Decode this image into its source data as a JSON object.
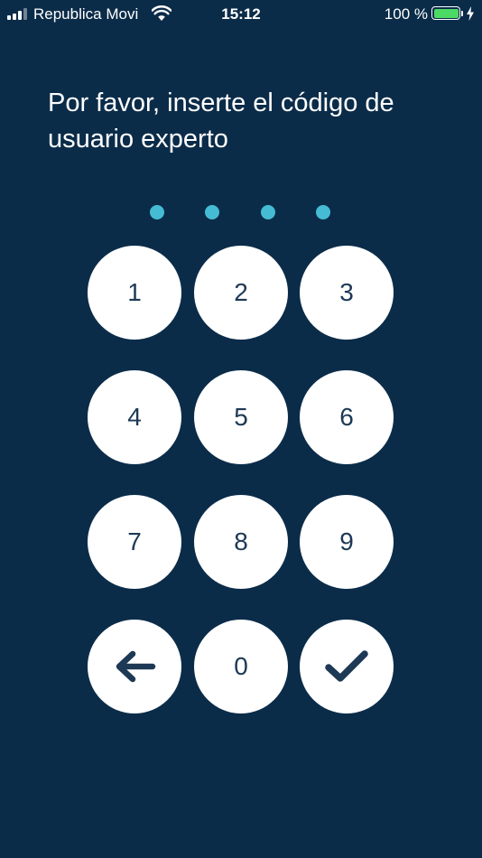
{
  "status_bar": {
    "carrier": "Republica Movi",
    "time": "15:12",
    "battery_percent": "100 %",
    "signal_bars_filled": 3,
    "signal_bars_total": 4,
    "icons": [
      "signal-icon",
      "wifi-icon",
      "battery-icon",
      "charging-bolt-icon"
    ],
    "battery_color": "#4cd964"
  },
  "prompt": {
    "text": "Por favor, inserte el código de usuario experto"
  },
  "pin": {
    "length": 4,
    "dot_color": "#45bcd3"
  },
  "keypad": {
    "key_1": "1",
    "key_2": "2",
    "key_3": "3",
    "key_4": "4",
    "key_5": "5",
    "key_6": "6",
    "key_7": "7",
    "key_8": "8",
    "key_9": "9",
    "key_0": "0",
    "back_icon": "arrow-left-icon",
    "confirm_icon": "checkmark-icon",
    "key_text_color": "#1d3955"
  },
  "colors": {
    "background": "#0b2c49",
    "key_background": "#ffffff"
  }
}
